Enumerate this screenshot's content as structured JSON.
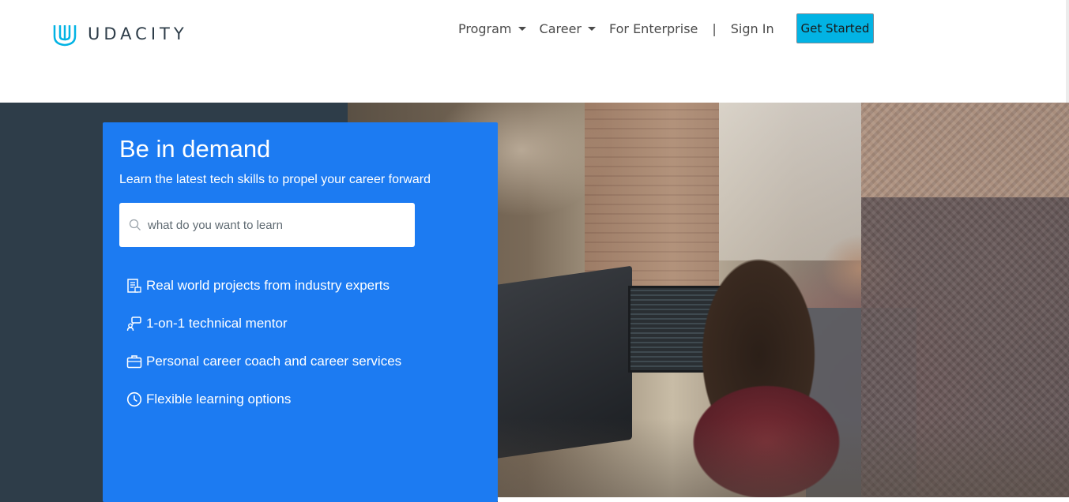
{
  "header": {
    "logo_text": "UDACITY",
    "nav": {
      "program": "Program",
      "career": "Career",
      "enterprise": "For Enterprise",
      "separator": "|",
      "sign_in": "Sign In"
    },
    "cta_label": "Get Started"
  },
  "hero": {
    "title": "Be in demand",
    "subtitle": "Learn the latest tech skills to propel your career forward",
    "search": {
      "placeholder": "what do you want to learn",
      "value": ""
    },
    "features": [
      {
        "icon": "project-document-icon",
        "label": "Real world projects from industry experts"
      },
      {
        "icon": "mentor-icon",
        "label": "1-on-1 technical mentor"
      },
      {
        "icon": "briefcase-icon",
        "label": "Personal career coach and career services"
      },
      {
        "icon": "clock-icon",
        "label": "Flexible learning options"
      }
    ]
  },
  "colors": {
    "brand_blue": "#1c7bf2",
    "cta_cyan": "#02b3e4",
    "logo_cyan": "#02b3e4",
    "dark_navy": "#2e3d49"
  }
}
